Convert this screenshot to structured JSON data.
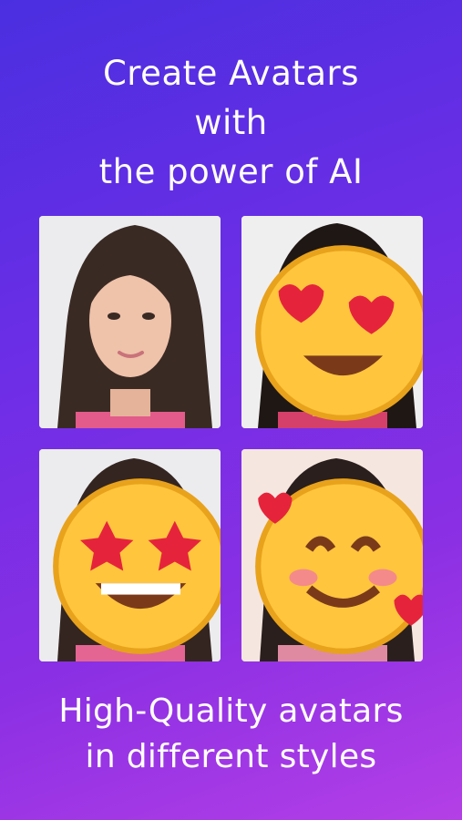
{
  "headline": {
    "line1": "Create Avatars",
    "line2": "with",
    "line3": "the power of AI"
  },
  "cards": [
    {
      "style": "photo",
      "badge": null
    },
    {
      "style": "painting",
      "badge": "heart-eyes-emoji"
    },
    {
      "style": "3d-cartoon",
      "badge": "star-struck-emoji"
    },
    {
      "style": "watercolor",
      "badge": "smiling-hearts-emoji"
    }
  ],
  "tagline": {
    "line1": "High-Quality avatars",
    "line2": "in different styles"
  },
  "colors": {
    "bg_start": "#4a2fe0",
    "bg_end": "#b43fe6",
    "text": "#ffffff"
  }
}
